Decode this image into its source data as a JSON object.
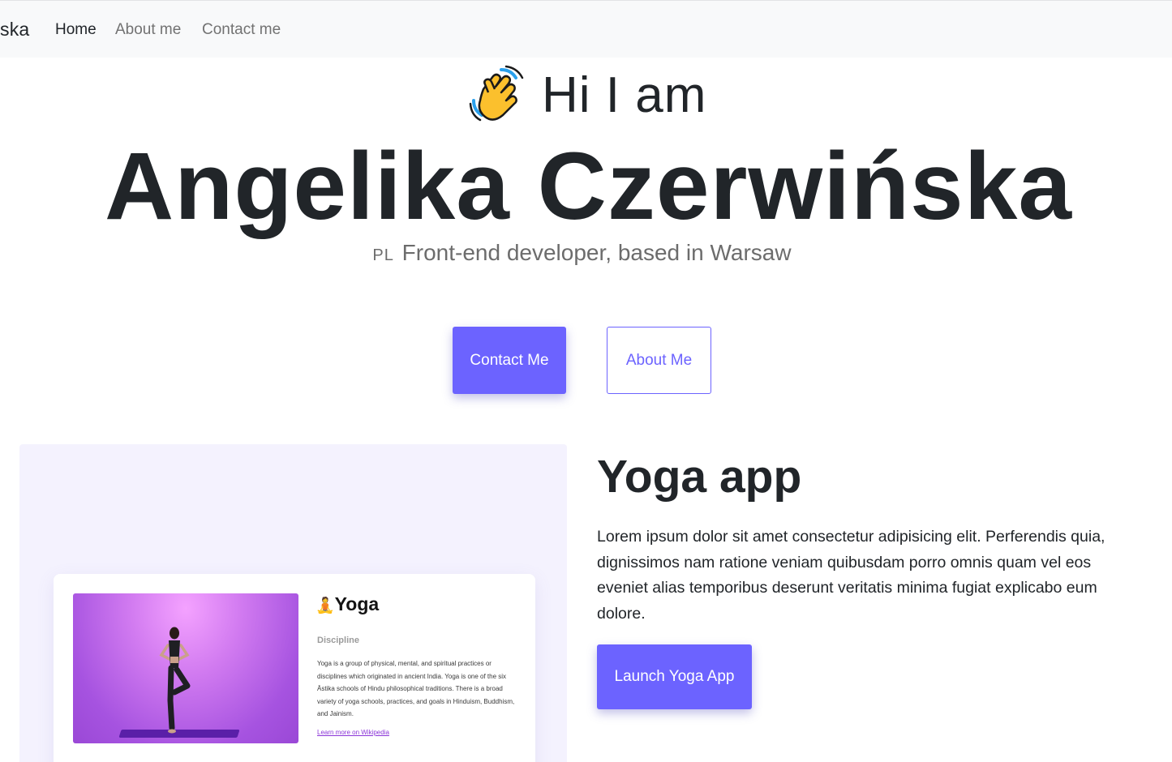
{
  "navbar": {
    "brand": "ska",
    "links": [
      {
        "label": "Home",
        "active": true
      },
      {
        "label": "About me",
        "active": false
      },
      {
        "label": "Contact me",
        "active": false
      }
    ]
  },
  "hero": {
    "wave_icon": "waving-hand-icon",
    "greeting": "Hi I am",
    "name": "Angelika Czerwińska",
    "flag_code": "PL",
    "subtitle": "Front-end developer, based in Warsaw",
    "contact_button": "Contact Me",
    "about_button": "About Me"
  },
  "project": {
    "title": "Yoga app",
    "description": "Lorem ipsum dolor sit amet consectetur adipisicing elit. Perferendis quia, dignissimos nam ratione veniam quibusdam porro omnis quam vel eos eveniet alias temporibus deserunt veritatis minima fugiat explicabo eum dolore.",
    "launch_button": "Launch Yoga App",
    "preview": {
      "title": "Yoga",
      "title_icon": "person-in-lotus-position-icon",
      "subtitle": "Discipline",
      "text": "Yoga is a group of physical, mental, and spiritual practices or disciplines which originated in ancient India. Yoga is one of the six Āstika schools of Hindu philosophical traditions. There is a broad variety of yoga schools, practices, and goals in Hinduism, Buddhism, and Jainism.",
      "link": "Learn more on Wikipedia"
    }
  },
  "colors": {
    "accent": "#6c63ff",
    "navbar_bg": "#f8f9fa",
    "panel_bg": "#f4f2fe",
    "text": "#212529",
    "muted": "#6c6c6c"
  }
}
